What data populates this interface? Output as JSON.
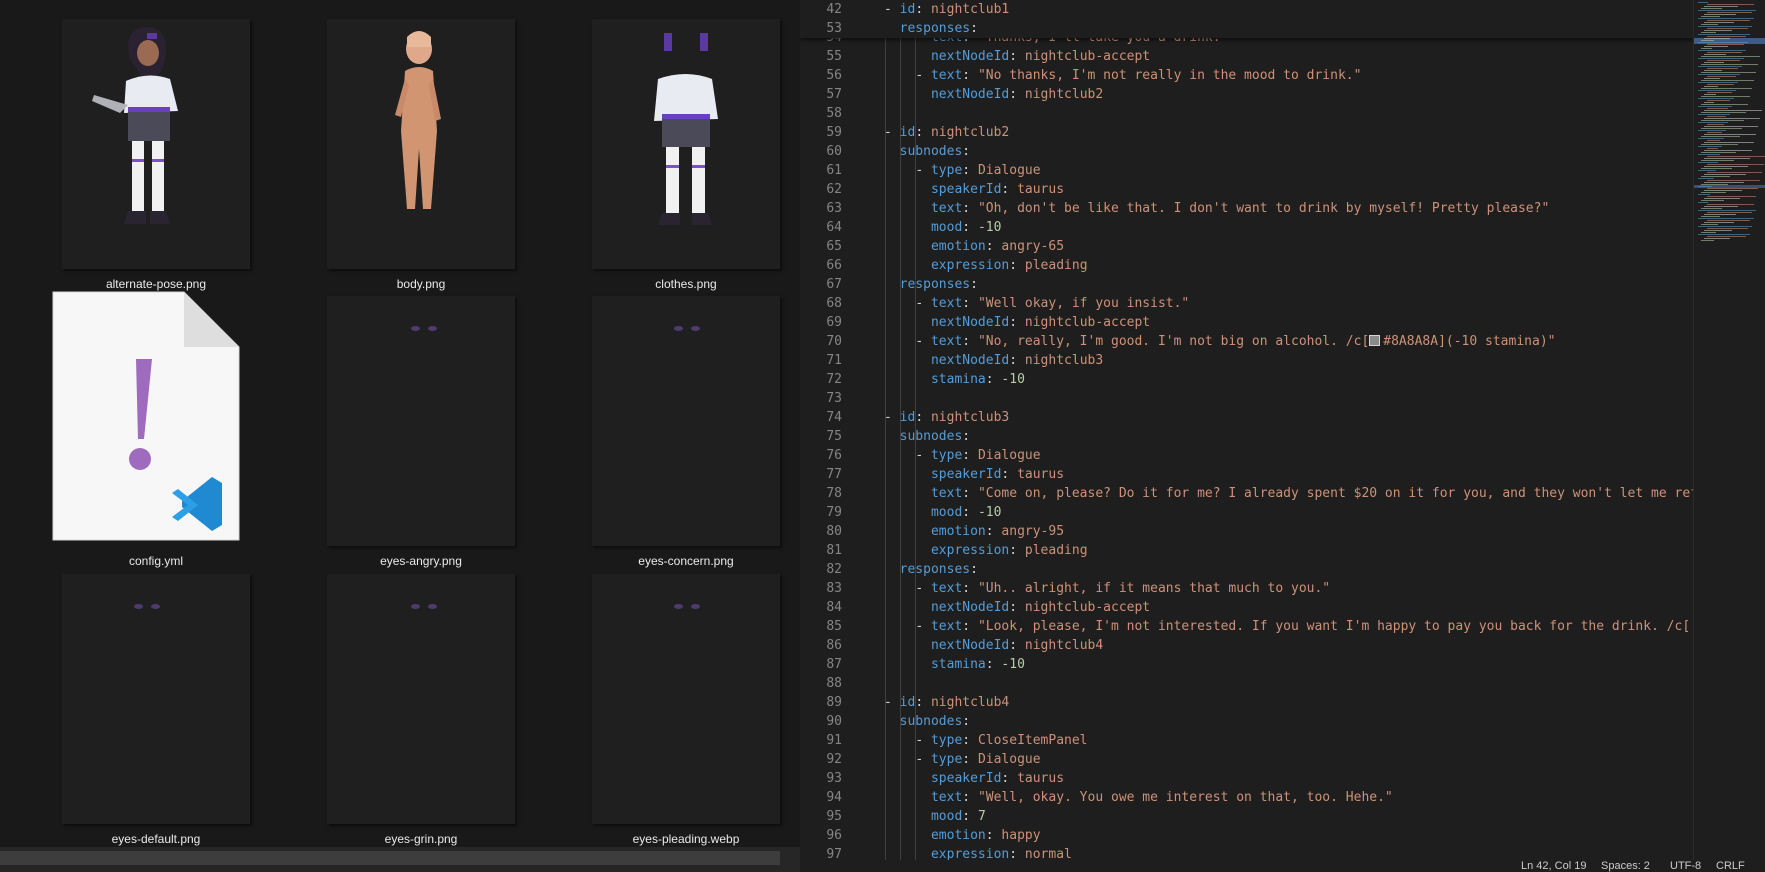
{
  "explorer": {
    "files": [
      {
        "name": "alternate-pose.png"
      },
      {
        "name": "body.png"
      },
      {
        "name": "clothes.png"
      },
      {
        "name": "config.yml"
      },
      {
        "name": "eyes-angry.png"
      },
      {
        "name": "eyes-concern.png"
      },
      {
        "name": "eyes-default.png"
      },
      {
        "name": "eyes-grin.png"
      },
      {
        "name": "eyes-pleading.webp"
      }
    ],
    "config_icon": "vscode-file-warning-icon"
  },
  "editor": {
    "sticky": [
      {
        "ln": "42",
        "text": "- id: nightclub1"
      },
      {
        "ln": "53",
        "text": "  responses:"
      }
    ],
    "lines": [
      {
        "ln": "54",
        "text": "    - text: \"Thanks, I'll take you a drink.\""
      },
      {
        "ln": "55",
        "text": "      nextNodeId: nightclub-accept"
      },
      {
        "ln": "56",
        "text": "    - text: \"No thanks, I'm not really in the mood to drink.\""
      },
      {
        "ln": "57",
        "text": "      nextNodeId: nightclub2"
      },
      {
        "ln": "58",
        "text": ""
      },
      {
        "ln": "59",
        "text": "- id: nightclub2"
      },
      {
        "ln": "60",
        "text": "  subnodes:"
      },
      {
        "ln": "61",
        "text": "    - type: Dialogue"
      },
      {
        "ln": "62",
        "text": "      speakerId: taurus"
      },
      {
        "ln": "63",
        "text": "      text: \"Oh, don't be like that. I don't want to drink by myself! Pretty please?\""
      },
      {
        "ln": "64",
        "text": "      mood: -10"
      },
      {
        "ln": "65",
        "text": "      emotion: angry-65"
      },
      {
        "ln": "66",
        "text": "      expression: pleading"
      },
      {
        "ln": "67",
        "text": "  responses:"
      },
      {
        "ln": "68",
        "text": "    - text: \"Well okay, if you insist.\""
      },
      {
        "ln": "69",
        "text": "      nextNodeId: nightclub-accept"
      },
      {
        "ln": "70",
        "text": "    - text: \"No, really, I'm good. I'm not big on alcohol. /c[#8A8A8A](-10 stamina)\""
      },
      {
        "ln": "71",
        "text": "      nextNodeId: nightclub3"
      },
      {
        "ln": "72",
        "text": "      stamina: -10"
      },
      {
        "ln": "73",
        "text": ""
      },
      {
        "ln": "74",
        "text": "- id: nightclub3"
      },
      {
        "ln": "75",
        "text": "  subnodes:"
      },
      {
        "ln": "76",
        "text": "    - type: Dialogue"
      },
      {
        "ln": "77",
        "text": "      speakerId: taurus"
      },
      {
        "ln": "78",
        "text": "      text: \"Come on, please? Do it for me? I already spent $20 on it for you, and they won't let me refund it!\""
      },
      {
        "ln": "79",
        "text": "      mood: -10"
      },
      {
        "ln": "80",
        "text": "      emotion: angry-95"
      },
      {
        "ln": "81",
        "text": "      expression: pleading"
      },
      {
        "ln": "82",
        "text": "  responses:"
      },
      {
        "ln": "83",
        "text": "    - text: \"Uh.. alright, if it means that much to you.\""
      },
      {
        "ln": "84",
        "text": "      nextNodeId: nightclub-accept"
      },
      {
        "ln": "85",
        "text": "    - text: \"Look, please, I'm not interested. If you want I'm happy to pay you back for the drink. /c["
      },
      {
        "ln": "86",
        "text": "      nextNodeId: nightclub4"
      },
      {
        "ln": "87",
        "text": "      stamina: -10"
      },
      {
        "ln": "88",
        "text": ""
      },
      {
        "ln": "89",
        "text": "- id: nightclub4"
      },
      {
        "ln": "90",
        "text": "  subnodes:"
      },
      {
        "ln": "91",
        "text": "    - type: CloseItemPanel"
      },
      {
        "ln": "92",
        "text": "    - type: Dialogue"
      },
      {
        "ln": "93",
        "text": "      speakerId: taurus"
      },
      {
        "ln": "94",
        "text": "      text: \"Well, okay. You owe me interest on that, too. Hehe.\""
      },
      {
        "ln": "95",
        "text": "      mood: 7"
      },
      {
        "ln": "96",
        "text": "      emotion: happy"
      },
      {
        "ln": "97",
        "text": "      expression: normal"
      }
    ]
  },
  "status": {
    "position": "Ln 42, Col 19",
    "spaces": "Spaces: 2",
    "encoding": "UTF-8",
    "eol": "CRLF"
  },
  "colors": {
    "keyword": "#569cd6",
    "string": "#ce9178",
    "number": "#b5cea8",
    "plain": "#d4d4d4",
    "swatch": "#8A8A8A"
  }
}
